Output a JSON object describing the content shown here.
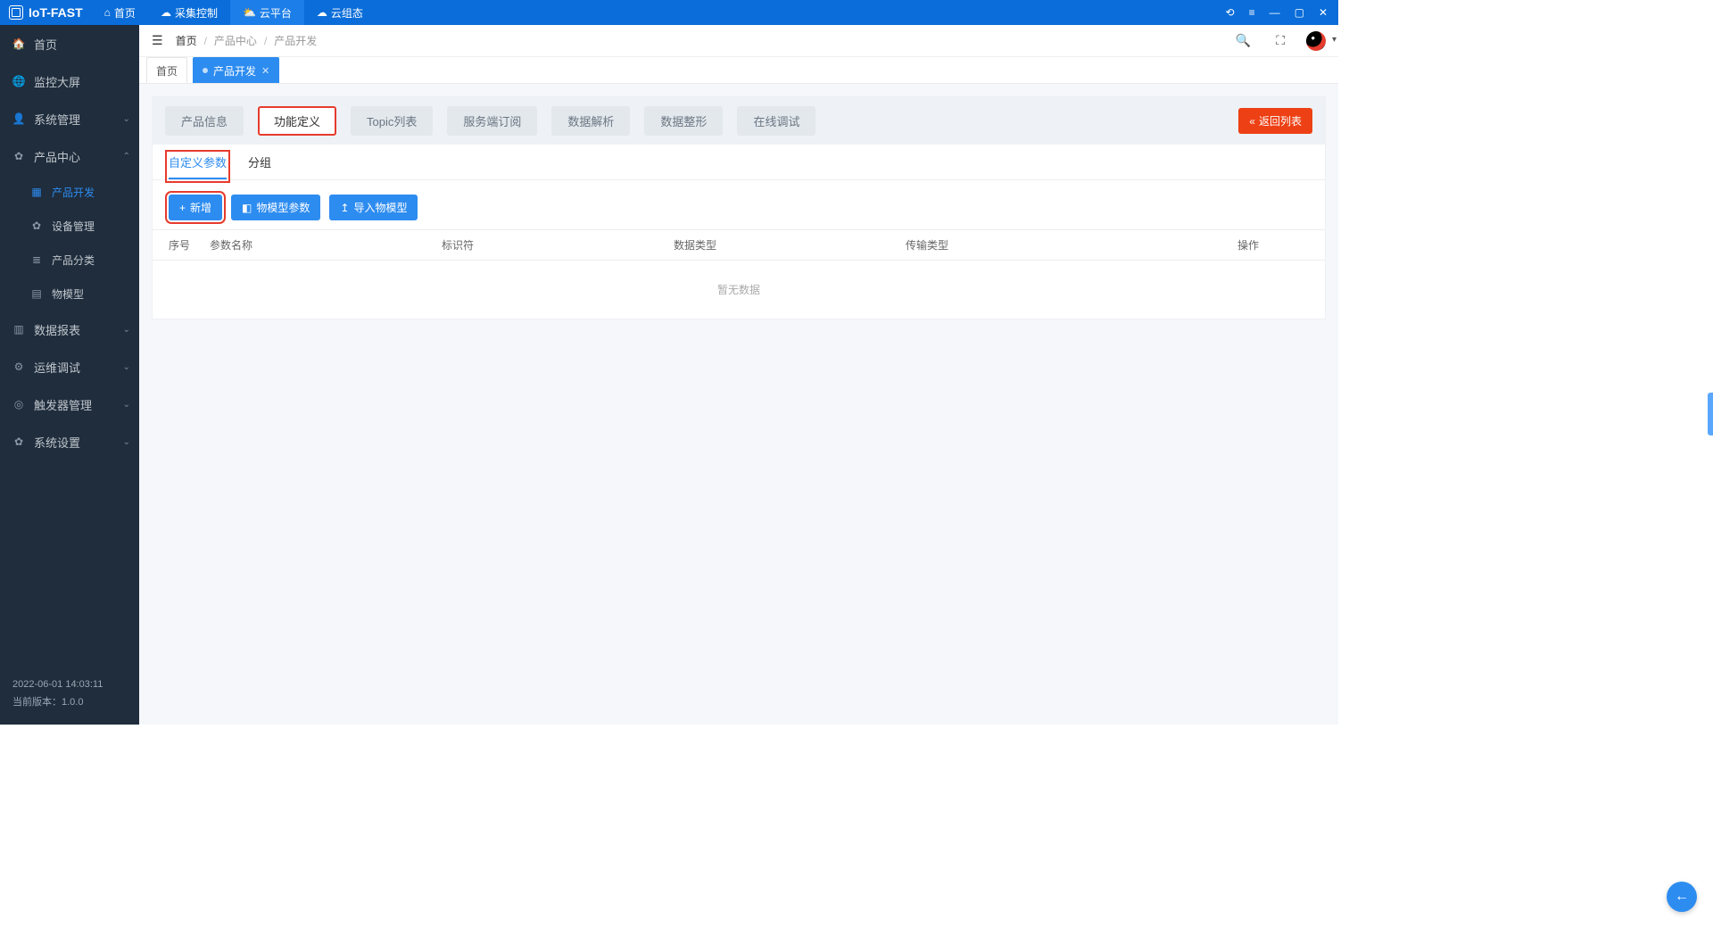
{
  "app": {
    "name": "IoT-FAST"
  },
  "topnav": {
    "items": [
      {
        "label": "首页",
        "icon": "⌂"
      },
      {
        "label": "采集控制",
        "icon": "☁"
      },
      {
        "label": "云平台",
        "icon": "⛅",
        "active": true
      },
      {
        "label": "云组态",
        "icon": "☁"
      }
    ]
  },
  "winctrl": {
    "refresh": "⟲",
    "menu": "≡",
    "min": "—",
    "max": "▢",
    "close": "✕"
  },
  "sidebar": {
    "items": [
      {
        "label": "首页",
        "icon": "🏠"
      },
      {
        "label": "监控大屏",
        "icon": "🌐"
      },
      {
        "label": "系统管理",
        "icon": "👤",
        "expandable": true
      },
      {
        "label": "产品中心",
        "icon": "✿",
        "expandable": true,
        "expanded": true
      },
      {
        "label": "产品开发",
        "icon": "▦",
        "child": true,
        "active": true
      },
      {
        "label": "设备管理",
        "icon": "✿",
        "child": true
      },
      {
        "label": "产品分类",
        "icon": "≣",
        "child": true
      },
      {
        "label": "物模型",
        "icon": "▤",
        "child": true
      },
      {
        "label": "数据报表",
        "icon": "▥",
        "expandable": true
      },
      {
        "label": "运维调试",
        "icon": "⚙",
        "expandable": true
      },
      {
        "label": "触发器管理",
        "icon": "◎",
        "expandable": true
      },
      {
        "label": "系统设置",
        "icon": "✿",
        "expandable": true
      }
    ],
    "footer": {
      "time": "2022-06-01 14:03:11",
      "version": "当前版本：1.0.0"
    }
  },
  "breadcrumb": {
    "items": [
      "首页",
      "产品中心",
      "产品开发"
    ]
  },
  "pagetabs": [
    {
      "label": "首页",
      "active": false
    },
    {
      "label": "产品开发",
      "active": true,
      "closable": true
    }
  ],
  "segments": [
    "产品信息",
    "功能定义",
    "Topic列表",
    "服务端订阅",
    "数据解析",
    "数据整形",
    "在线调试"
  ],
  "segment_active_index": 1,
  "back_button": "返回列表",
  "subtabs": [
    "自定义参数",
    "分组"
  ],
  "subtab_active_index": 0,
  "action_buttons": {
    "add": "新增",
    "model_params": "物模型参数",
    "import_model": "导入物模型"
  },
  "table": {
    "columns": {
      "idx": "序号",
      "name": "参数名称",
      "ident": "标识符",
      "dtype": "数据类型",
      "ttype": "传输类型",
      "op": "操作"
    },
    "empty": "暂无数据"
  },
  "highlighted": {
    "segment": 1,
    "subtab": 0,
    "add_button": true
  }
}
